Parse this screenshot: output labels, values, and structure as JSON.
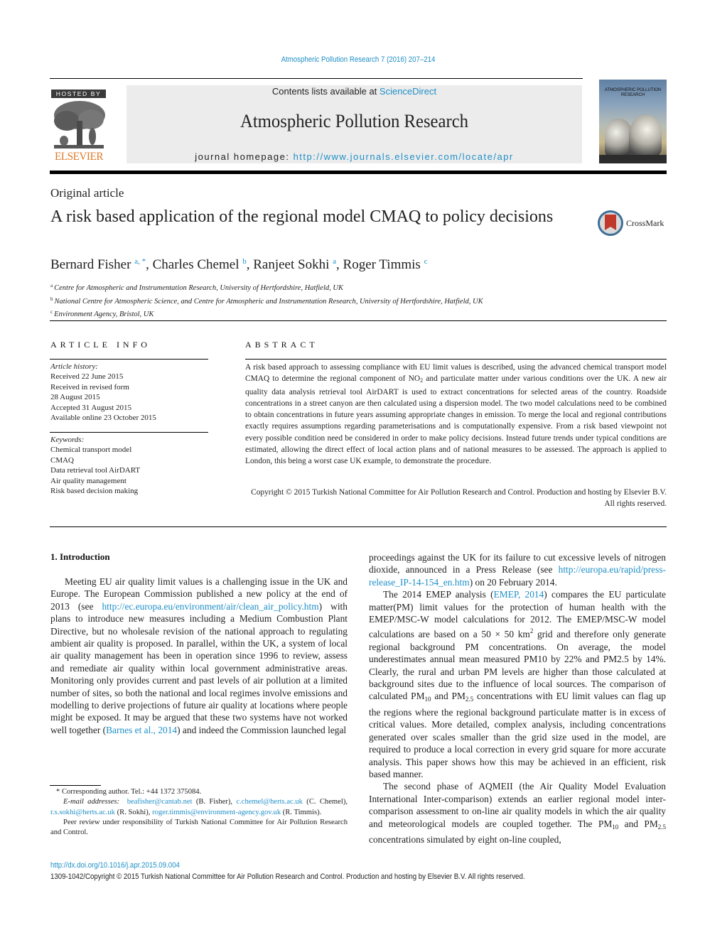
{
  "header": {
    "citation": "Atmospheric Pollution Research 7 (2016) 207–214",
    "hosted_by": "HOSTED BY",
    "publisher_logo": "ELSEVIER",
    "contents_prefix": "Contents lists available at ",
    "contents_link": "ScienceDirect",
    "journal_title": "Atmospheric Pollution Research",
    "homepage_prefix": "journal homepage: ",
    "homepage_link": "http://www.journals.elsevier.com/locate/apr",
    "cover_title_line1": "ATMOSPHERIC POLLUTION",
    "cover_title_line2": "RESEARCH"
  },
  "article": {
    "type": "Original article",
    "title": "A risk based application of the regional model CMAQ to policy decisions",
    "crossmark_label": "CrossMark",
    "authors": [
      {
        "name": "Bernard Fisher",
        "sup": "a, *"
      },
      {
        "name": "Charles Chemel",
        "sup": "b"
      },
      {
        "name": "Ranjeet Sokhi",
        "sup": "a"
      },
      {
        "name": "Roger Timmis",
        "sup": "c"
      }
    ],
    "affiliations": [
      {
        "mark": "a",
        "text": "Centre for Atmospheric and Instrumentation Research, University of Hertfordshire, Hatfield, UK"
      },
      {
        "mark": "b",
        "text": "National Centre for Atmospheric Science, and Centre for Atmospheric and Instrumentation Research, University of Hertfordshire, Hatfield, UK"
      },
      {
        "mark": "c",
        "text": "Environment Agency, Bristol, UK"
      }
    ]
  },
  "article_info": {
    "heading": "ARTICLE INFO",
    "history_label": "Article history:",
    "history": [
      "Received 22 June 2015",
      "Received in revised form",
      "28 August 2015",
      "Accepted 31 August 2015",
      "Available online 23 October 2015"
    ],
    "keywords_label": "Keywords:",
    "keywords": [
      "Chemical transport model",
      "CMAQ",
      "Data retrieval tool AirDART",
      "Air quality management",
      "Risk based decision making"
    ]
  },
  "abstract": {
    "heading": "ABSTRACT",
    "part1": "A risk based approach to assessing compliance with EU limit values is described, using the advanced chemical transport model CMAQ to determine the regional component of NO",
    "part1_sub": "2",
    "part2": " and particulate matter under various conditions over the UK. A new air quality data analysis retrieval tool AirDART is used to extract concentrations for selected areas of the country. Roadside concentrations in a street canyon are then calculated using a dispersion model. The two model calculations need to be combined to obtain concentrations in future years assuming appropriate changes in emission. To merge the local and regional contributions exactly requires assumptions regarding parameterisations and is computationally expensive. From a risk based viewpoint not every possible condition need be considered in order to make policy decisions. Instead future trends under typical conditions are estimated, allowing the direct effect of local action plans and of national measures to be assessed. The approach is applied to London, this being a worst case UK example, to demonstrate the procedure.",
    "copyright": "Copyright © 2015 Turkish National Committee for Air Pollution Research and Control. Production and hosting by Elsevier B.V. All rights reserved."
  },
  "body": {
    "section_heading": "1.  Introduction",
    "left": {
      "p1_a": "Meeting EU air quality limit values is a challenging issue in the UK and Europe. The European Commission published a new policy at the end of 2013 (see ",
      "p1_link": "http://ec.europa.eu/environment/air/clean_air_policy.htm",
      "p1_b": ") with plans to introduce new measures including a Medium Combustion Plant Directive, but no wholesale revision of the national approach to regulating ambient air quality is proposed. In parallel, within the UK, a system of local air quality management has been in operation since 1996 to review, assess and remediate air quality within local government administrative areas. Monitoring only provides current and past levels of air pollution at a limited number of sites, so both the national and local regimes involve emissions and modelling to derive projections of future air quality at locations where people might be exposed. It may be argued that these two systems have not worked well together (",
      "p1_ref": "Barnes et al., 2014",
      "p1_c": ") and indeed the Commission launched legal"
    },
    "right": {
      "p1_a": "proceedings against the UK for its failure to cut excessive levels of nitrogen dioxide, announced in a Press Release (see ",
      "p1_link": "http://europa.eu/rapid/press-release_IP-14-154_en.htm",
      "p1_b": ") on 20 February 2014.",
      "p2_a": "The 2014 EMEP analysis (",
      "p2_ref": "EMEP, 2014",
      "p2_b": ") compares the EU particulate matter(PM) limit values for the protection of human health with the EMEP/MSC-W model calculations for 2012. The EMEP/MSC-W model calculations are based on a 50 × 50 km",
      "p2_sup": "2",
      "p2_c": " grid and therefore only generate regional background PM concentrations. On average, the model underestimates annual mean measured PM10 by 22% and PM2.5 by 14%. Clearly, the rural and urban PM levels are higher than those calculated at background sites due to the influence of local sources. The comparison of calculated PM",
      "p2_sub1": "10",
      "p2_d": " and PM",
      "p2_sub2": "2.5",
      "p2_e": " concentrations with EU limit values can flag up the regions where the regional background particulate matter is in excess of critical values. More detailed, complex analysis, including concentrations generated over scales smaller than the grid size used in the model, are required to produce a local correction in every grid square for more accurate analysis. This paper shows how this may be achieved in an efficient, risk based manner.",
      "p3_a": "The second phase of AQMEII (the Air Quality Model Evaluation International Inter-comparison) extends an earlier regional model inter-comparison assessment to on-line air quality models in which the air quality and meteorological models are coupled together. The PM",
      "p3_sub1": "10",
      "p3_b": " and PM",
      "p3_sub2": "2.5",
      "p3_c": " concentrations simulated by eight on-line coupled,"
    }
  },
  "footnotes": {
    "corresponding": "* Corresponding author. Tel.: +44 1372 375084.",
    "email_label": "E-mail addresses:",
    "emails": [
      {
        "address": "beafisher@cantab.net",
        "name": " (B. Fisher), "
      },
      {
        "address": "c.chemel@herts.ac.uk",
        "name": " (C. Chemel), "
      },
      {
        "address": "r.s.sokhi@herts.ac.uk",
        "name": " (R. Sokhi), "
      },
      {
        "address": "roger.timmis@environment-agency.gov.uk",
        "name": " (R. Timmis)."
      }
    ],
    "peer_review": "Peer review under responsibility of Turkish National Committee for Air Pollution Research and Control."
  },
  "footer": {
    "doi": "http://dx.doi.org/10.1016/j.apr.2015.09.004",
    "issn_copyright": "1309-1042/Copyright © 2015 Turkish National Committee for Air Pollution Research and Control. Production and hosting by Elsevier B.V. All rights reserved."
  }
}
